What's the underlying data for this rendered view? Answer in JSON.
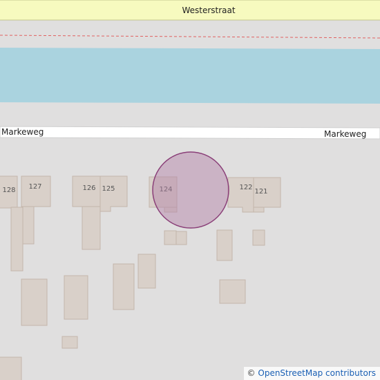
{
  "streets": {
    "top": "Westerstraat",
    "middle_left": "Markeweg",
    "middle_right": "Markeweg"
  },
  "house_numbers": {
    "n128": "128",
    "n127": "127",
    "n126": "126",
    "n125": "125",
    "n124": "124",
    "n122": "122",
    "n121": "121"
  },
  "attribution": {
    "symbol": "©",
    "text": "OpenStreetMap contributors"
  },
  "colors": {
    "background": "#e0dfdf",
    "water": "#aad3df",
    "primary_road": "#f7fabf",
    "road": "#ffffff",
    "building_fill": "#d9d0c9",
    "building_stroke": "#c4b6ab",
    "marker_fill": "#b27ea6",
    "marker_stroke": "#8a3f78"
  }
}
